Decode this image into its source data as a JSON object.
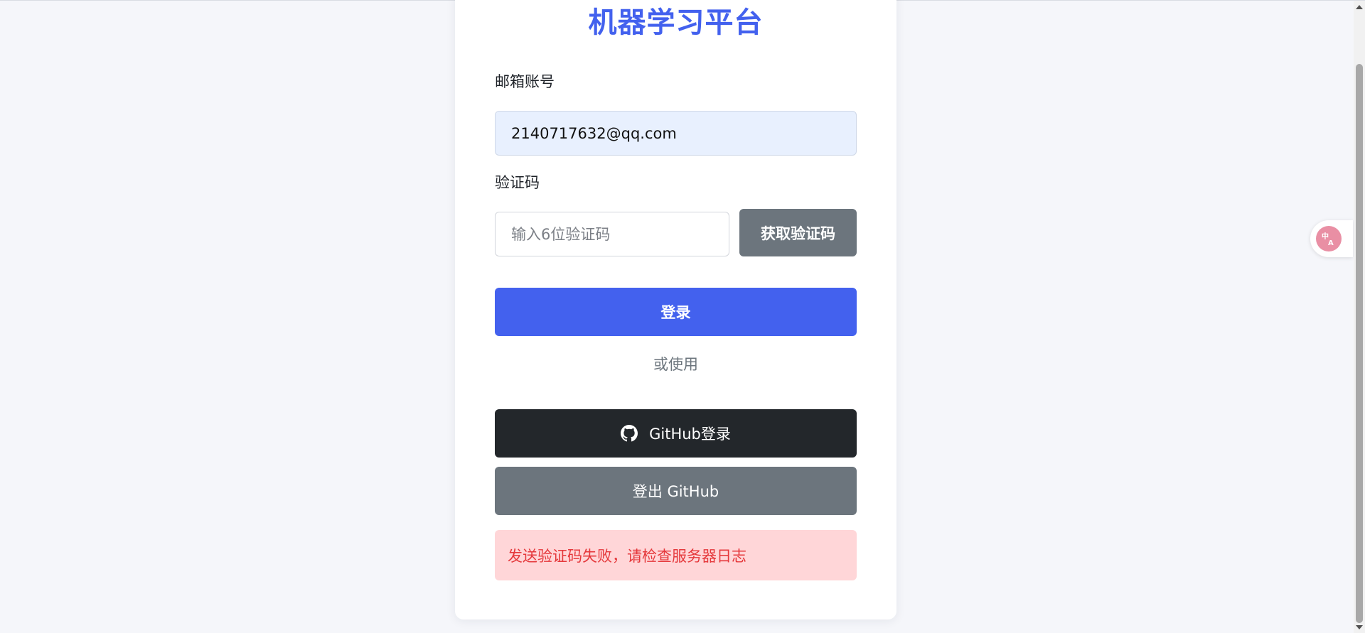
{
  "page": {
    "title": "机器学习平台"
  },
  "form": {
    "email_label": "邮箱账号",
    "email_value": "2140717632@qq.com",
    "code_label": "验证码",
    "code_placeholder": "输入6位验证码",
    "get_code_label": "获取验证码",
    "login_label": "登录",
    "divider_text": "或使用",
    "github_login_label": "GitHub登录",
    "github_logout_label": "登出 GitHub"
  },
  "alert": {
    "message": "发送验证码失败，请检查服务器日志"
  },
  "translate_widget": {
    "icon": "translate-icon"
  },
  "colors": {
    "accent": "#4361ee",
    "secondary": "#6c757d",
    "dark": "#23272b",
    "error_bg": "#ffd6d8",
    "error_text": "#e5383b",
    "input_autofill_bg": "#e8f0fe"
  }
}
